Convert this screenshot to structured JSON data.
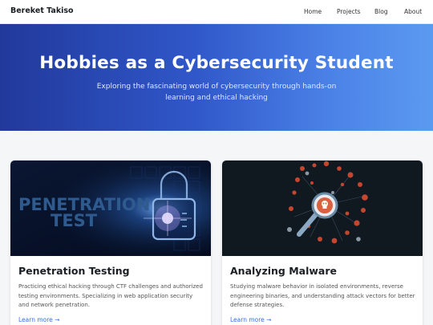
{
  "navbar": {
    "brand": "Bereket Takiso",
    "links": [
      "Home",
      "Projects",
      "Blog",
      "About"
    ]
  },
  "hero": {
    "title": "Hobbies as a Cybersecurity Student",
    "subtitle": "Exploring the fascinating world of cybersecurity through hands-on learning and ethical hacking"
  },
  "cards": [
    {
      "image_text": "PENETRATION TEST",
      "image_text_line1": "PENETRATION",
      "image_text_line2": "TEST",
      "title": "Penetration Testing",
      "description": "Practicing ethical hacking through CTF challenges and authorized testing environments. Specializing in web application security and network penetration.",
      "link": "Learn more →"
    },
    {
      "title": "Analyzing Malware",
      "description": "Studying malware behavior in isolated environments, reverse engineering binaries, and understanding attack vectors for better defense strategies.",
      "link": "Learn more →"
    }
  ],
  "colors": {
    "accent": "#3a6ee6",
    "hero_start": "#21399b",
    "hero_end": "#5b9af1"
  }
}
